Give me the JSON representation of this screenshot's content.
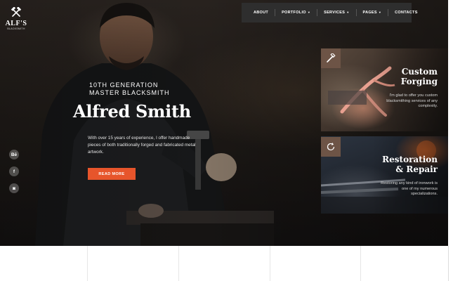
{
  "brand": {
    "name": "ALF'S",
    "tagline": "BLACKSMITH"
  },
  "nav": {
    "items": [
      {
        "label": "ABOUT",
        "has_dropdown": false
      },
      {
        "label": "PORTFOLIO",
        "has_dropdown": true
      },
      {
        "label": "SERVICES",
        "has_dropdown": true
      },
      {
        "label": "PAGES",
        "has_dropdown": true
      },
      {
        "label": "CONTACTS",
        "has_dropdown": false
      }
    ]
  },
  "hero": {
    "eyebrow_line1": "10TH GENERATION",
    "eyebrow_line2": "MASTER BLACKSMITH",
    "title": "Alfred Smith",
    "description": "With over 15 years of experience, I offer handmade pieces of both traditionally forged and fabricated metal artwork.",
    "cta_label": "READ MORE"
  },
  "social": {
    "behance": "Bē",
    "facebook": "f",
    "instagram": "◙"
  },
  "cards": [
    {
      "title_line1": "Custom",
      "title_line2": "Forging",
      "text": "I'm glad to offer you custom blacksmithing services of any complexity.",
      "icon": "hammer-icon"
    },
    {
      "title_line1": "Restoration",
      "title_line2": "& Repair",
      "text": "Restoring any kind of ironwork is one of my numerous specializations.",
      "icon": "refresh-icon"
    }
  ],
  "colors": {
    "accent": "#e7552b",
    "card_icon_bg": "#6d5446",
    "nav_bg": "#2e2e2e"
  }
}
